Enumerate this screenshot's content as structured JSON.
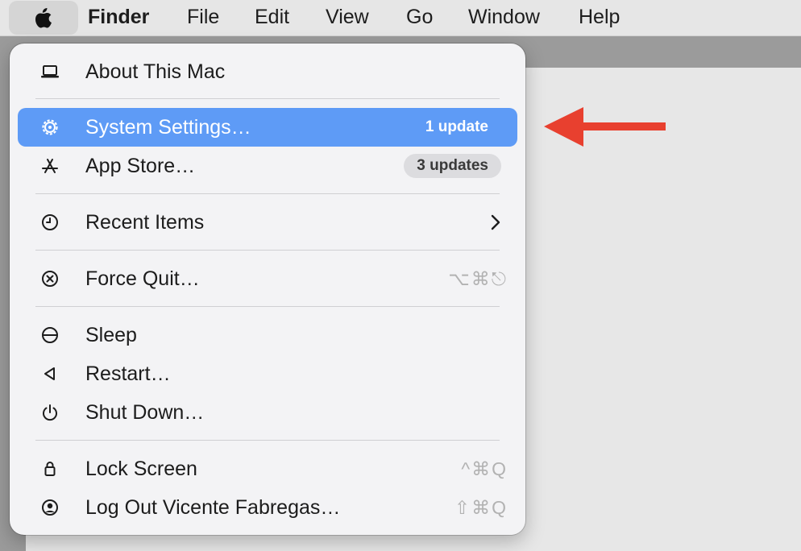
{
  "menubar": {
    "finder": "Finder",
    "file": "File",
    "edit": "Edit",
    "view": "View",
    "go": "Go",
    "window": "Window",
    "help": "Help"
  },
  "menu": {
    "about": "About This Mac",
    "system_settings": "System Settings…",
    "system_settings_badge": "1 update",
    "app_store": "App Store…",
    "app_store_badge": "3 updates",
    "recent_items": "Recent Items",
    "force_quit": "Force Quit…",
    "force_quit_shortcut": "⌥⌘⎋",
    "sleep": "Sleep",
    "restart": "Restart…",
    "shut_down": "Shut Down…",
    "lock_screen": "Lock Screen",
    "lock_screen_shortcut": "^⌘Q",
    "log_out": "Log Out Vicente Fabregas…",
    "log_out_shortcut": "⇧⌘Q"
  },
  "colors": {
    "highlight": "#5e9bf6",
    "arrow": "#e8402f"
  },
  "icons": [
    "apple-logo-icon",
    "laptop-icon",
    "gear-icon",
    "app-store-icon",
    "clock-icon",
    "chevron-right-icon",
    "x-circle-icon",
    "sleep-icon",
    "restart-triangle-icon",
    "power-icon",
    "lock-icon",
    "user-circle-icon",
    "red-arrow-icon"
  ]
}
